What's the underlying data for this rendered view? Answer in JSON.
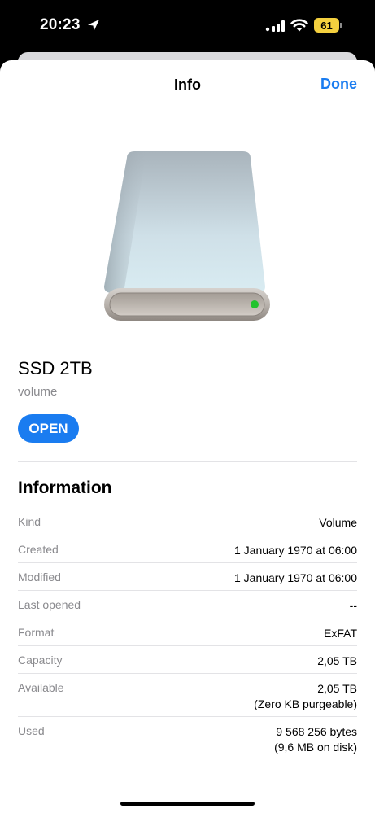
{
  "status_bar": {
    "time": "20:23",
    "battery": "61"
  },
  "nav": {
    "title": "Info",
    "done_label": "Done"
  },
  "item": {
    "name": "SSD 2TB",
    "kind": "volume",
    "open_label": "OPEN",
    "icon": "external-drive-icon"
  },
  "information": {
    "title": "Information",
    "rows": [
      {
        "label": "Kind",
        "value": "Volume"
      },
      {
        "label": "Created",
        "value": "1 January 1970 at 06:00"
      },
      {
        "label": "Modified",
        "value": "1 January 1970 at 06:00"
      },
      {
        "label": "Last opened",
        "value": "--"
      },
      {
        "label": "Format",
        "value": "ExFAT"
      },
      {
        "label": "Capacity",
        "value": "2,05 TB"
      },
      {
        "label": "Available",
        "value": "2,05 TB",
        "value2": "(Zero KB purgeable)"
      },
      {
        "label": "Used",
        "value": "9 568 256 bytes",
        "value2": "(9,6 MB on disk)"
      }
    ]
  },
  "colors": {
    "accent": "#1a7cf0",
    "battery": "#f4d03f",
    "drive_led": "#22c32e"
  }
}
